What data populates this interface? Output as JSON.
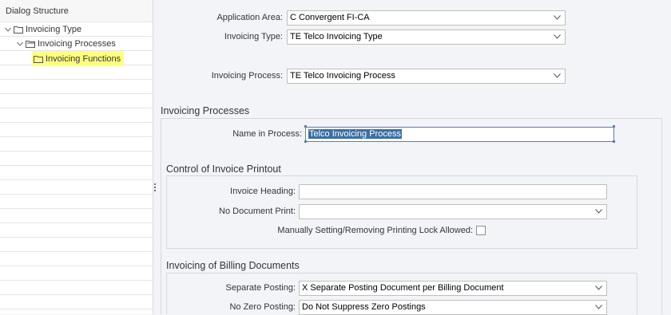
{
  "tree": {
    "header": "Dialog Structure",
    "items": [
      {
        "label": "Invoicing Type"
      },
      {
        "label": "Invoicing Processes"
      },
      {
        "label": "Invoicing Functions"
      }
    ]
  },
  "header_fields": {
    "application_area": {
      "label": "Application Area:",
      "value": "C Convergent FI-CA"
    },
    "invoicing_type": {
      "label": "Invoicing Type:",
      "value": "TE Telco Invoicing Type"
    },
    "invoicing_process": {
      "label": "Invoicing Process:",
      "value": "TE Telco Invoicing Process"
    }
  },
  "sections": {
    "invoicing_processes": {
      "title": "Invoicing Processes",
      "name_in_process": {
        "label": "Name in Process:",
        "value": "Telco Invoicing Process"
      }
    },
    "control_printout": {
      "title": "Control of Invoice Printout",
      "invoice_heading": {
        "label": "Invoice Heading:",
        "value": ""
      },
      "no_document_print": {
        "label": "No Document Print:",
        "value": ""
      },
      "printing_lock": {
        "label": "Manually Setting/Removing Printing Lock Allowed:",
        "checked": false
      }
    },
    "billing_documents": {
      "title": "Invoicing of Billing Documents",
      "separate_posting": {
        "label": "Separate Posting:",
        "value": "X Separate Posting Document per Billing Document"
      },
      "no_zero_posting": {
        "label": "No Zero Posting:",
        "value": "Do Not Suppress Zero Postings"
      }
    }
  },
  "colors": {
    "highlight": "#ffff7f",
    "selection": "#3a6ea5"
  }
}
